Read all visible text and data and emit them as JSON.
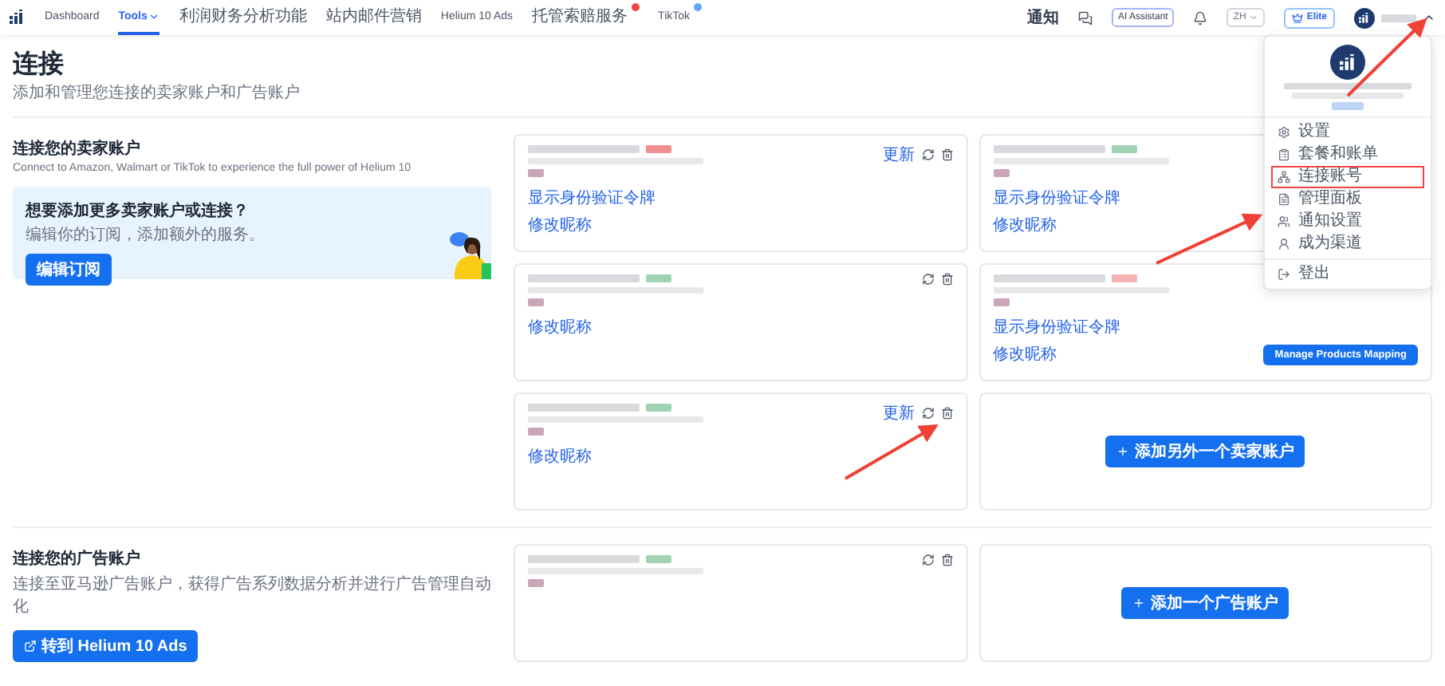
{
  "nav": {
    "items": [
      {
        "label": "Dashboard",
        "selected": false
      },
      {
        "label": "Tools",
        "selected": true,
        "caret": true
      },
      {
        "label": "利润财务分析功能",
        "selected": false
      },
      {
        "label": "站内邮件营销",
        "selected": false
      },
      {
        "label": "Helium 10 Ads",
        "selected": false
      },
      {
        "label": "托管索赔服务",
        "selected": false,
        "color": "#ef4444"
      },
      {
        "label": "TikTok",
        "selected": false,
        "color": "#60a5fa"
      }
    ],
    "notify": "通知",
    "assistant": "AI Assistant",
    "language": "ZH",
    "plan": "Elite"
  },
  "page": {
    "title": "连接",
    "subtitle": "添加和管理您连接的卖家账户和广告账户"
  },
  "seller_section": {
    "title": "连接您的卖家账户",
    "description": "Connect to Amazon, Walmart or TikTok to experience the full power of Helium 10",
    "promo": {
      "title": "想要添加更多卖家账户或连接？",
      "text": "编辑你的订阅，添加额外的服务。",
      "button": "编辑订阅"
    },
    "cards": [
      {
        "kind": "account",
        "color": "#f08f8f",
        "update": "更新",
        "refresh": true,
        "delete": true,
        "links": [
          "显示身份验证令牌",
          "修改昵称"
        ]
      },
      {
        "kind": "account",
        "color": "#9fd3b4",
        "refresh": false,
        "delete": false,
        "links": [
          "显示身份验证令牌",
          "修改昵称"
        ]
      },
      {
        "kind": "account",
        "color": "#9fd3b4",
        "refresh": true,
        "delete": true,
        "links": [
          "修改昵称"
        ]
      },
      {
        "kind": "account",
        "color": "#f4b4b4",
        "refresh": false,
        "delete": false,
        "links": [
          "显示身份验证令牌",
          "修改昵称"
        ],
        "button": "Manage Products Mapping"
      },
      {
        "kind": "account",
        "color": "#9fd3b4",
        "update": "更新",
        "refresh": true,
        "delete": true,
        "links": [
          "修改昵称"
        ]
      },
      {
        "kind": "add",
        "button": "添加另外一个卖家账户"
      }
    ]
  },
  "ads_section": {
    "title": "连接您的广告账户",
    "description": "连接至亚马逊广告账户，获得广告系列数据分析并进行广告管理自动化",
    "button": "转到 Helium 10 Ads",
    "cards": [
      {
        "kind": "account",
        "color": "#9fd3b4",
        "refresh": true,
        "delete": true
      },
      {
        "kind": "add",
        "button": "添加一个广告账户"
      }
    ]
  },
  "user_menu": {
    "expanded": true,
    "items": [
      {
        "label": "设置",
        "selected": false
      },
      {
        "label": "套餐和账单",
        "selected": false
      },
      {
        "label": "连接账号",
        "selected": true
      },
      {
        "label": "管理面板",
        "selected": false
      },
      {
        "label": "通知设置",
        "selected": false
      },
      {
        "label": "成为渠道",
        "selected": false
      }
    ],
    "logout": "登出"
  }
}
